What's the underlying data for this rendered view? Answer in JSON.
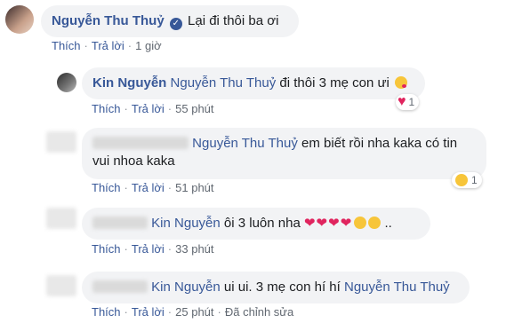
{
  "comments": [
    {
      "author": "Nguyễn Thu Thuỷ",
      "verified": true,
      "text": "Lại đi thôi ba ơi",
      "like": "Thích",
      "reply": "Trả lời",
      "time": "1 giờ"
    },
    {
      "author": "Kin Nguyễn",
      "tag": "Nguyễn Thu Thuỷ",
      "text": "đi thôi 3 mẹ con ưi",
      "like": "Thích",
      "reply": "Trả lời",
      "time": "55 phút",
      "reaction": {
        "icon": "heart",
        "count": "1"
      }
    },
    {
      "tag": "Nguyễn Thu Thuỷ",
      "text_line1": "em biết rồi nha kaka có tin",
      "text_line2": "vui nhoa kaka",
      "like": "Thích",
      "reply": "Trả lời",
      "time": "51 phút",
      "reaction": {
        "icon": "laughing-face",
        "count": "1"
      }
    },
    {
      "tag": "Kin Nguyễn",
      "text": "ôi 3 luôn nha",
      "like": "Thích",
      "reply": "Trả lời",
      "time": "33 phút"
    },
    {
      "tag": "Kin Nguyễn",
      "text": "ui ui. 3 mẹ con hí hí",
      "tag2": "Nguyễn Thu Thuỷ",
      "like": "Thích",
      "reply": "Trả lời",
      "time": "25 phút",
      "edited": "Đã chỉnh sửa"
    }
  ],
  "colors": {
    "link": "#385898",
    "bubble": "#f2f3f5",
    "meta": "#606770"
  }
}
